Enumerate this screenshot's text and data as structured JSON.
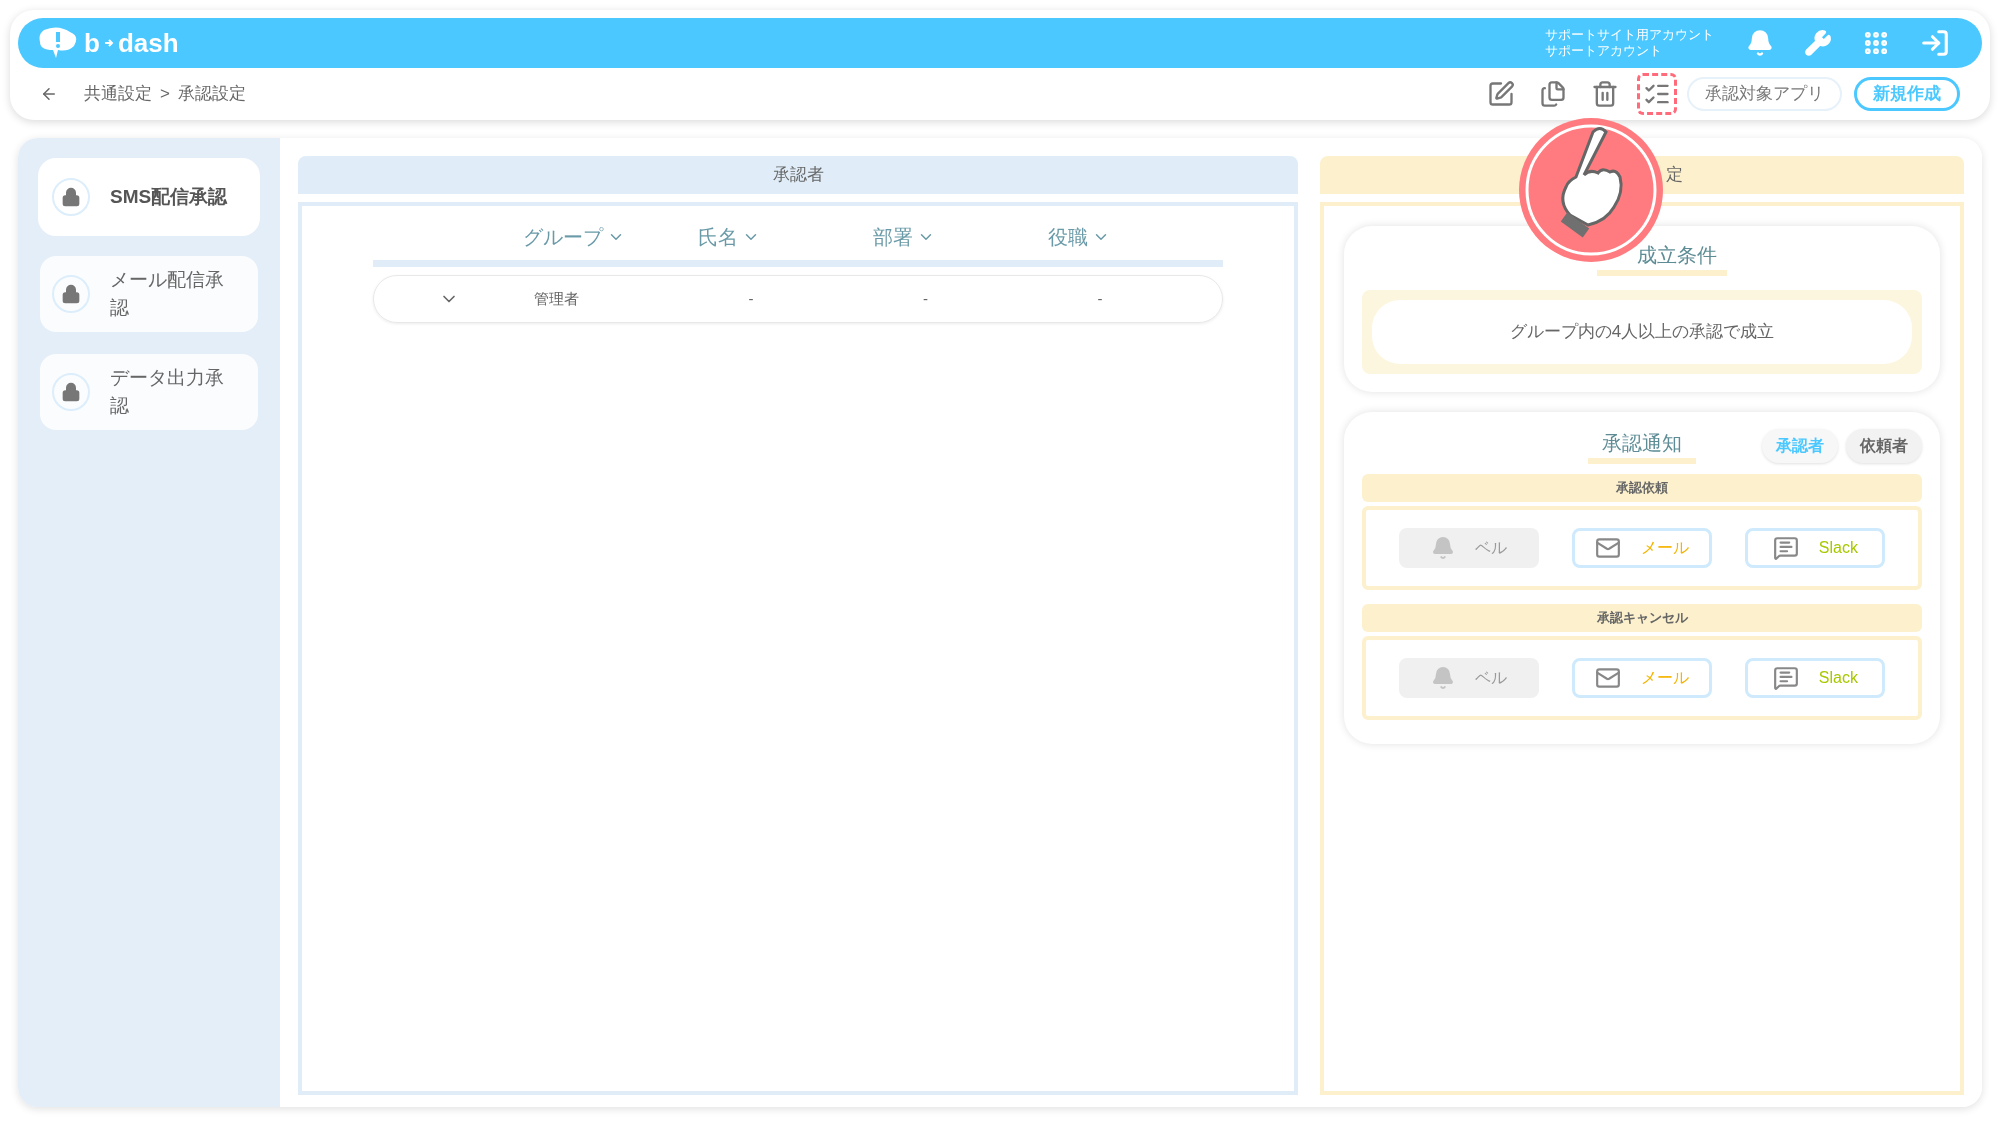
{
  "header": {
    "logo": [
      "b",
      "dash"
    ],
    "account": [
      "サポートサイト用アカウント",
      "サポートアカウント"
    ]
  },
  "breadcrumb": {
    "items": [
      "共通設定",
      "承認設定"
    ],
    "separator": ">"
  },
  "toolbar": {
    "tools": [
      {
        "kind": "edit",
        "highlighted": false
      },
      {
        "kind": "copy",
        "highlighted": false
      },
      {
        "kind": "trash",
        "highlighted": false
      },
      {
        "kind": "list-check",
        "highlighted": true
      }
    ],
    "buttons": [
      {
        "label": "承認対象アプリ",
        "kind": "outline"
      },
      {
        "label": "新規作成",
        "kind": "primary"
      }
    ]
  },
  "sidebar": {
    "items": [
      {
        "label": "SMS配信承認",
        "selected": true
      },
      {
        "label": "メール配信承認",
        "selected": false
      },
      {
        "label": "データ出力承認",
        "selected": false
      }
    ]
  },
  "approvers": {
    "title": "承認者",
    "columns": [
      "グループ",
      "氏名",
      "部署",
      "役職"
    ],
    "rows": [
      {
        "cells": [
          "管理者",
          "-",
          "-",
          "-"
        ],
        "expanded": false
      }
    ]
  },
  "settings": {
    "title": "定",
    "condition": {
      "title": "成立条件",
      "text": "グループ内の4人以上の承認で成立"
    },
    "notification": {
      "title": "承認通知",
      "tabs": [
        {
          "label": "承認者",
          "selected": true
        },
        {
          "label": "依頼者",
          "selected": false
        }
      ],
      "sections": [
        {
          "title": "承認依頼",
          "channels": [
            {
              "kind": "bell",
              "label": "ベル",
              "enabled": false
            },
            {
              "kind": "mail",
              "label": "メール",
              "enabled": true
            },
            {
              "kind": "slack",
              "label": "Slack",
              "enabled": true
            }
          ]
        },
        {
          "title": "承認キャンセル",
          "channels": [
            {
              "kind": "bell",
              "label": "ベル",
              "enabled": false
            },
            {
              "kind": "mail",
              "label": "メール",
              "enabled": true
            },
            {
              "kind": "slack",
              "label": "Slack",
              "enabled": true
            }
          ]
        }
      ]
    }
  }
}
